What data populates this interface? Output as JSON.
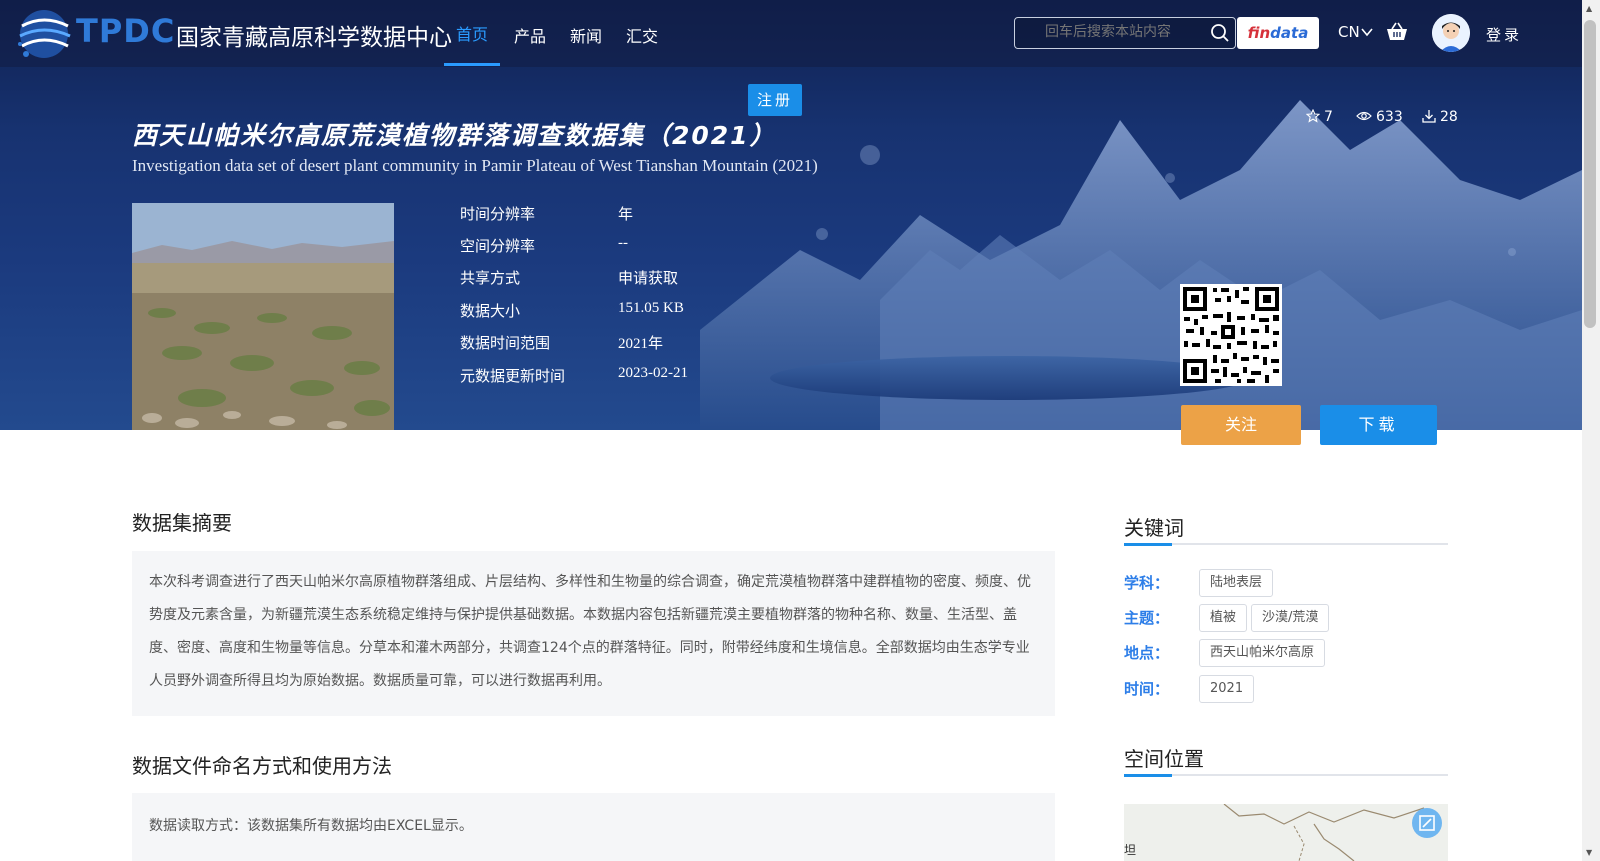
{
  "brand": {
    "abbr": "TPDC",
    "name": "国家青藏高原科学数据中心",
    "colors": {
      "abbr": "#2f7ad8",
      "accent": "#1a8ee8",
      "follow": "#eca247",
      "label": "#2d7ee8"
    }
  },
  "nav": {
    "items": [
      {
        "label": "首页",
        "active": true
      },
      {
        "label": "产品",
        "active": false
      },
      {
        "label": "新闻",
        "active": false
      },
      {
        "label": "汇交",
        "active": false
      }
    ],
    "search_placeholder": "回车后搜索本站内容",
    "findata_prefix": "fin",
    "findata_suffix": "data",
    "lang": "CN",
    "login": "登录"
  },
  "dataset": {
    "register_label": "注册",
    "title_cn": "西天山帕米尔高原荒漠植物群落调查数据集（2021）",
    "title_en": "Investigation data set of desert plant community in Pamir Plateau of West Tianshan Mountain (2021)",
    "stats": {
      "stars": "7",
      "views": "633",
      "downloads": "28"
    },
    "meta": [
      {
        "key": "时间分辨率",
        "value": "年"
      },
      {
        "key": "空间分辨率",
        "value": "--"
      },
      {
        "key": "共享方式",
        "value": "申请获取"
      },
      {
        "key": "数据大小",
        "value": "151.05 KB"
      },
      {
        "key": "数据时间范围",
        "value": "2021年"
      },
      {
        "key": "元数据更新时间",
        "value": "2023-02-21"
      }
    ],
    "follow_label": "关注",
    "download_label": "下载"
  },
  "abstract": {
    "title": "数据集摘要",
    "text": "本次科考调查进行了西天山帕米尔高原植物群落组成、片层结构、多样性和生物量的综合调查，确定荒漠植物群落中建群植物的密度、频度、优势度及元素含量，为新疆荒漠生态系统稳定维持与保护提供基础数据。本数据内容包括新疆荒漠主要植物群落的物种名称、数量、生活型、盖度、密度、高度和生物量等信息。分草本和灌木两部分，共调查124个点的群落特征。同时，附带经纬度和生境信息。全部数据均由生态学专业人员野外调查所得且均为原始数据。数据质量可靠，可以进行数据再利用。"
  },
  "usage": {
    "title": "数据文件命名方式和使用方法",
    "text": "数据读取方式：该数据集所有数据均由EXCEL显示。"
  },
  "keywords": {
    "title": "关键词",
    "groups": [
      {
        "label": "学科：",
        "tags": [
          "陆地表层"
        ]
      },
      {
        "label": "主题：",
        "tags": [
          "植被",
          "沙漠/荒漠"
        ]
      },
      {
        "label": "地点：",
        "tags": [
          "西天山帕米尔高原"
        ]
      },
      {
        "label": "时间：",
        "tags": [
          "2021"
        ]
      }
    ]
  },
  "location": {
    "title": "空间位置",
    "map_label": "坦"
  }
}
